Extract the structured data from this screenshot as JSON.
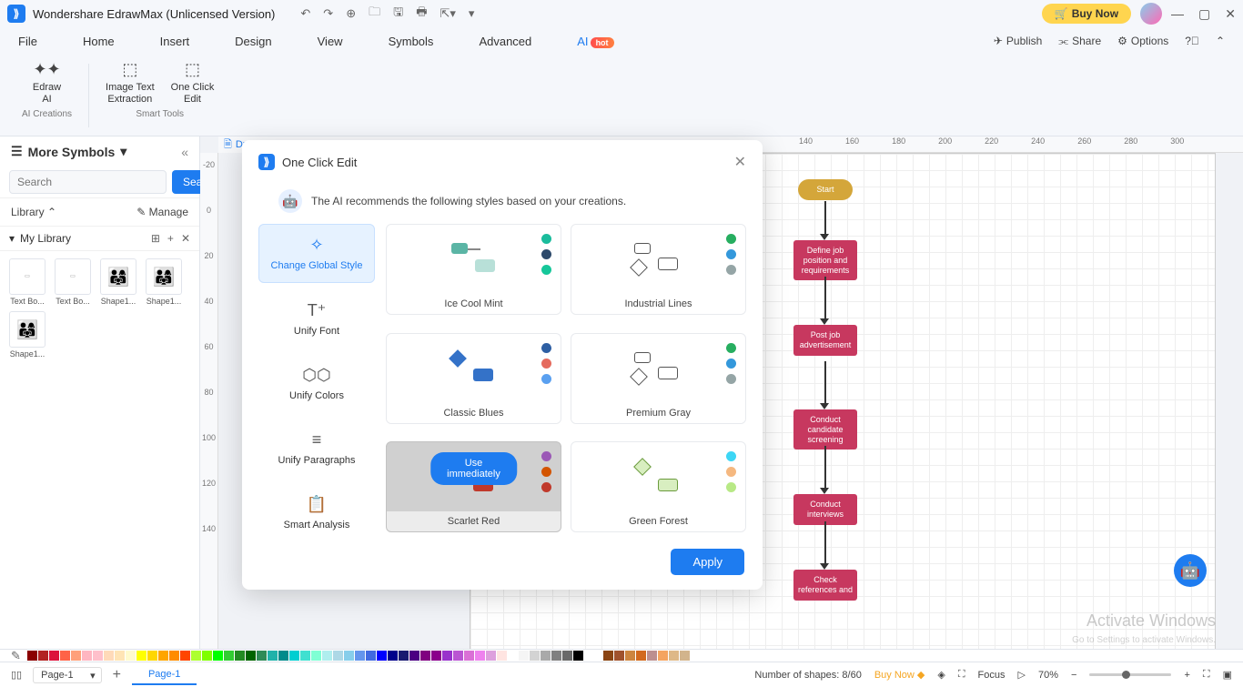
{
  "title": "Wondershare EdrawMax (Unlicensed Version)",
  "titlebar": {
    "buy_now": "Buy Now"
  },
  "menu": {
    "items": [
      "File",
      "Home",
      "Insert",
      "Design",
      "View",
      "Symbols",
      "Advanced",
      "AI"
    ],
    "active": "AI",
    "badge": "hot",
    "right": {
      "publish": "Publish",
      "share": "Share",
      "options": "Options"
    }
  },
  "ribbon": {
    "group1": {
      "label": "AI Creations",
      "item": "Edraw\nAI"
    },
    "group2": {
      "label": "Smart Tools",
      "item1": "Image Text\nExtraction",
      "item2": "One Click\nEdit"
    }
  },
  "sidebar": {
    "more_symbols": "More Symbols",
    "search_placeholder": "Search",
    "search_btn": "Search",
    "library": "Library",
    "manage": "Manage",
    "my_library": "My Library",
    "shapes": [
      "Text Bo...",
      "Text Bo...",
      "Shape1...",
      "Shape1...",
      "Shape1..."
    ]
  },
  "canvas": {
    "tab": "Dr",
    "nodes": {
      "start": "Start",
      "n1": "Define job position and requirements",
      "n2": "Post job advertisement",
      "n3": "Conduct candidate screening",
      "n4": "Conduct interviews",
      "n5": "Check references and"
    },
    "ruler_values": [
      "140",
      "160",
      "180",
      "200",
      "220",
      "240",
      "260",
      "280",
      "300"
    ],
    "ruler_v_values": [
      "-20",
      "0",
      "20",
      "40",
      "60",
      "80",
      "100",
      "120",
      "140"
    ]
  },
  "modal": {
    "title": "One Click Edit",
    "subtitle": "The AI recommends the following styles based on your creations.",
    "left": [
      "Change Global Style",
      "Unify Font",
      "Unify Colors",
      "Unify Paragraphs",
      "Smart Analysis"
    ],
    "styles": [
      {
        "name": "Ice Cool Mint",
        "dots": [
          "#1abc9c",
          "#2e4a6b",
          "#16c79a"
        ]
      },
      {
        "name": "Industrial Lines",
        "dots": [
          "#27ae60",
          "#3498db",
          "#95a5a6"
        ]
      },
      {
        "name": "Classic Blues",
        "dots": [
          "#2e5fa3",
          "#e56b5e",
          "#5aa0f0"
        ]
      },
      {
        "name": "Premium Gray",
        "dots": [
          "#27ae60",
          "#3498db",
          "#95a5a6"
        ]
      },
      {
        "name": "Scarlet Red",
        "dots": [
          "#9b59b6",
          "#d35400",
          "#c0392b"
        ],
        "hovered": true
      },
      {
        "name": "Green Forest",
        "dots": [
          "#3dd6f5",
          "#f5b880",
          "#b8e986"
        ]
      }
    ],
    "use_btn": "Use immediately",
    "apply": "Apply"
  },
  "status": {
    "page_dropdown": "Page-1",
    "page_tab": "Page-1",
    "shapes_count": "Number of shapes: 8/60",
    "buy_now": "Buy Now",
    "focus": "Focus",
    "zoom": "70%"
  },
  "watermark": {
    "main": "Activate Windows",
    "sub": "Go to Settings to activate Windows."
  }
}
